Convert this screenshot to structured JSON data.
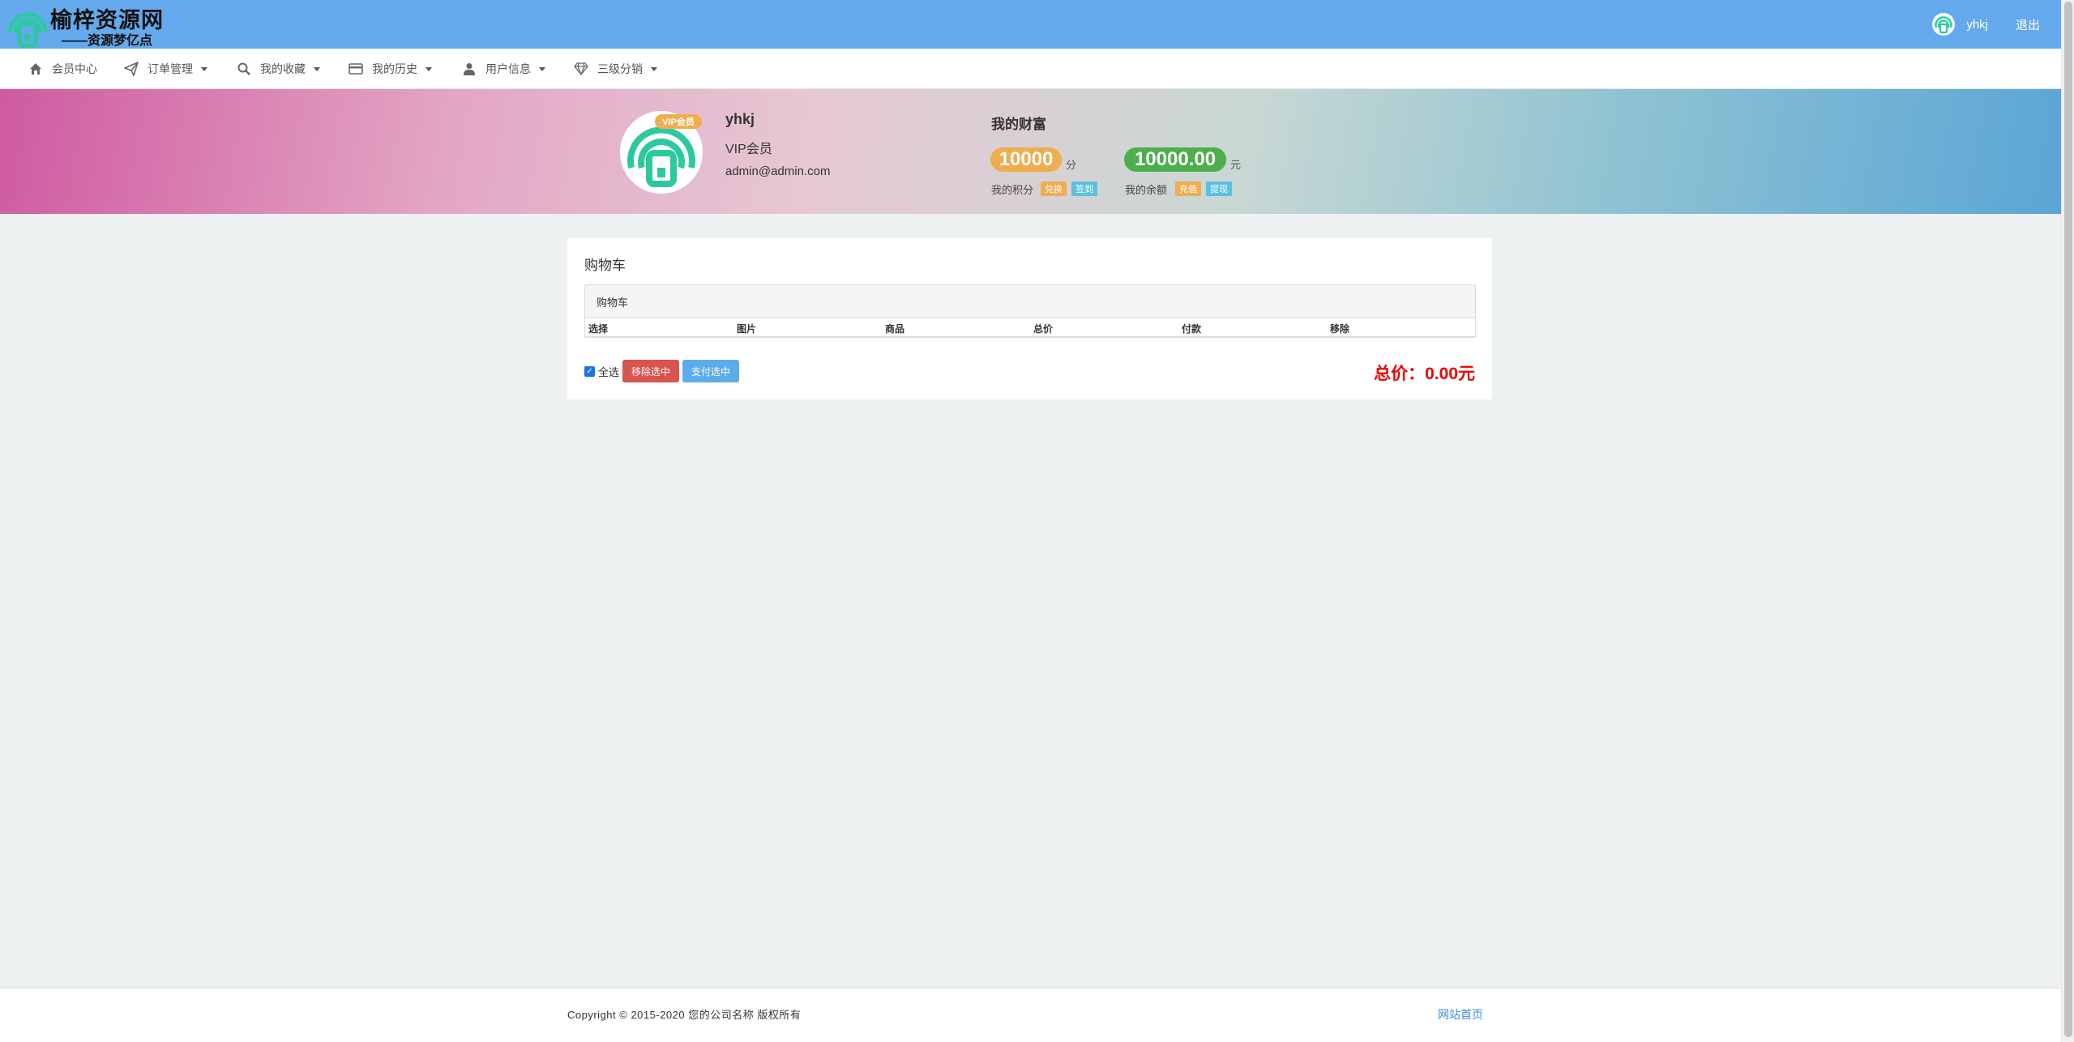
{
  "colors": {
    "header_bg": "#64a9eb",
    "accent_orange": "#f0ad4e",
    "accent_green": "#4cae4c",
    "accent_blue": "#5bc0de",
    "danger": "#d9534f",
    "total_red": "#ee0000"
  },
  "header": {
    "logo_title": "榆梓资源网",
    "logo_subtitle": "——资源梦亿点",
    "logo_icon": "wifi-lock-logo-icon",
    "username": "yhkj",
    "logout": "退出"
  },
  "nav": {
    "items": [
      {
        "label": "会员中心",
        "icon": "home-icon",
        "has_caret": false
      },
      {
        "label": "订单管理",
        "icon": "paper-plane-icon",
        "has_caret": true
      },
      {
        "label": "我的收藏",
        "icon": "search-icon",
        "has_caret": true
      },
      {
        "label": "我的历史",
        "icon": "credit-card-icon",
        "has_caret": true
      },
      {
        "label": "用户信息",
        "icon": "user-icon",
        "has_caret": true
      },
      {
        "label": "三级分销",
        "icon": "diamond-icon",
        "has_caret": true
      }
    ]
  },
  "profile": {
    "vip_badge": "VIP会员",
    "name": "yhkj",
    "level": "VIP会员",
    "email": "admin@admin.com"
  },
  "wealth": {
    "title": "我的财富",
    "points_value": "10000",
    "points_unit": "分",
    "points_label": "我的积分",
    "exchange": "兑换",
    "checkin": "签到",
    "balance_value": "10000.00",
    "balance_unit": "元",
    "balance_label": "我的余额",
    "recharge": "充值",
    "withdraw": "提现"
  },
  "cart": {
    "title": "购物车",
    "panel_title": "购物车",
    "columns": [
      "选择",
      "图片",
      "商品",
      "总价",
      "付款",
      "移除"
    ],
    "select_all": "全选",
    "remove_selected": "移除选中",
    "pay_selected": "支付选中",
    "total": "总价：0.00元"
  },
  "footer": {
    "copyright": "Copyright © 2015-2020 您的公司名称 版权所有",
    "home_link": "网站首页"
  }
}
